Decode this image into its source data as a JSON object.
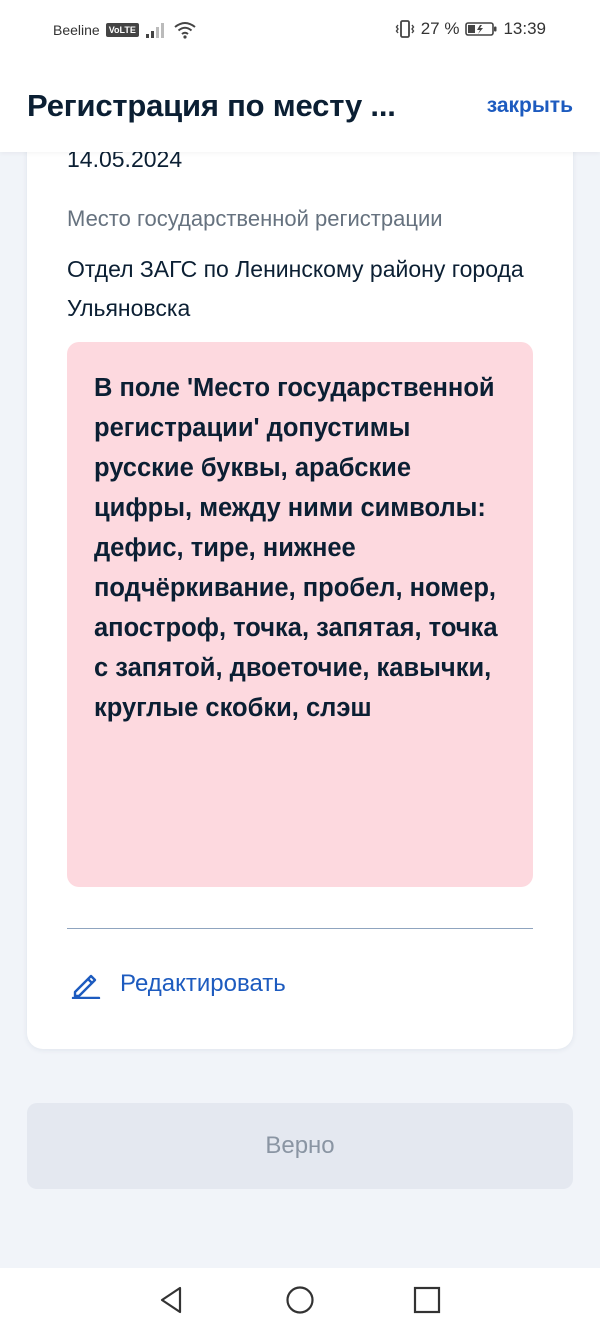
{
  "status_bar": {
    "carrier": "Beeline",
    "volte_badge": "VoLTE",
    "battery_percent": "27 %",
    "time": "13:39"
  },
  "header": {
    "title": "Регистрация по месту ...",
    "close_label": "закрыть"
  },
  "card": {
    "date_value": "14.05.2024",
    "place_label": "Место государственной регистрации",
    "place_value": "Отдел ЗАГС по Ленинскому району города Ульяновска",
    "error_message": "В поле 'Место государственной регистрации' допустимы русские буквы, арабские цифры, между ними символы: дефис, тире, нижнее подчёркивание, пробел, номер, апостроф, точка, запятая, точка с запятой, двоеточие, кавычки, круглые скобки, слэш",
    "edit_label": "Редактировать"
  },
  "confirm_button": {
    "label": "Верно"
  },
  "colors": {
    "accent": "#1d5bbf",
    "error_bg": "#fdd9df",
    "page_bg": "#f1f4f9",
    "button_disabled_bg": "#e4e8f0"
  },
  "icons": {
    "signal": "signal-bars-icon",
    "wifi": "wifi-icon",
    "vibrate": "vibrate-icon",
    "battery": "battery-icon",
    "edit": "pencil-icon",
    "back": "nav-back-icon",
    "home": "nav-home-icon",
    "recents": "nav-recents-icon"
  }
}
